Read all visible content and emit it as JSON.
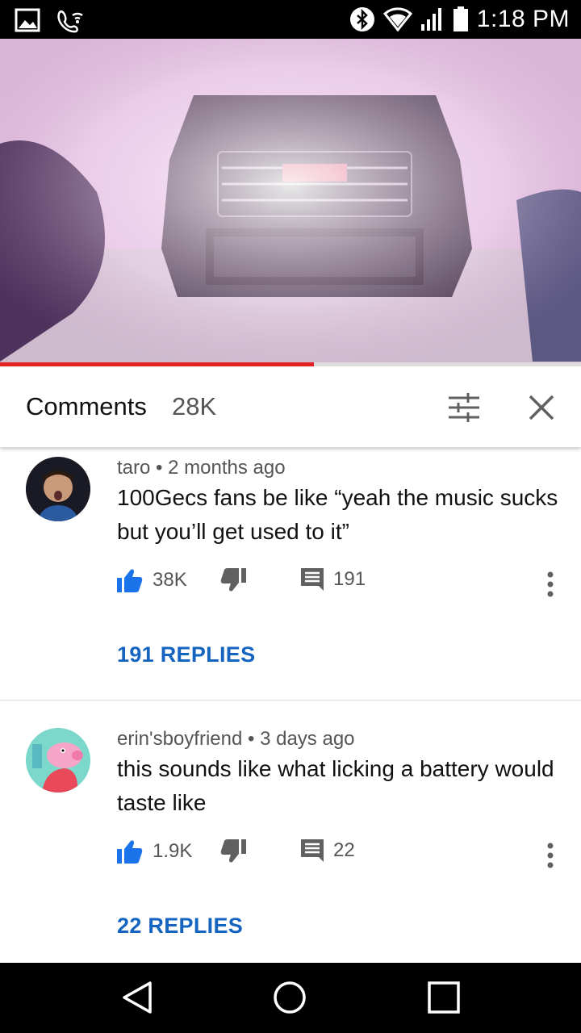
{
  "status_bar": {
    "time": "1:18 PM",
    "icons": [
      "gallery-icon",
      "wifi-calling-icon",
      "bluetooth-icon",
      "wifi-icon",
      "signal-icon",
      "battery-icon"
    ]
  },
  "video": {
    "progress_percent": 54,
    "progress_color": "#e52222"
  },
  "comments_header": {
    "title": "Comments",
    "count": "28K"
  },
  "comments": [
    {
      "author": "taro",
      "time": "2 months ago",
      "text": "100Gecs fans be like “yeah the music sucks but you’ll get used to it”",
      "likes": "38K",
      "reply_count": "191",
      "replies_label": "191 REPLIES"
    },
    {
      "author": "erin'sboyfriend",
      "time": "3 days ago",
      "text": "this sounds like what licking a battery would taste like",
      "likes": "1.9K",
      "reply_count": "22",
      "replies_label": "22 REPLIES"
    }
  ],
  "colors": {
    "accent_blue": "#1565c0",
    "like_blue": "#1a73e8"
  }
}
